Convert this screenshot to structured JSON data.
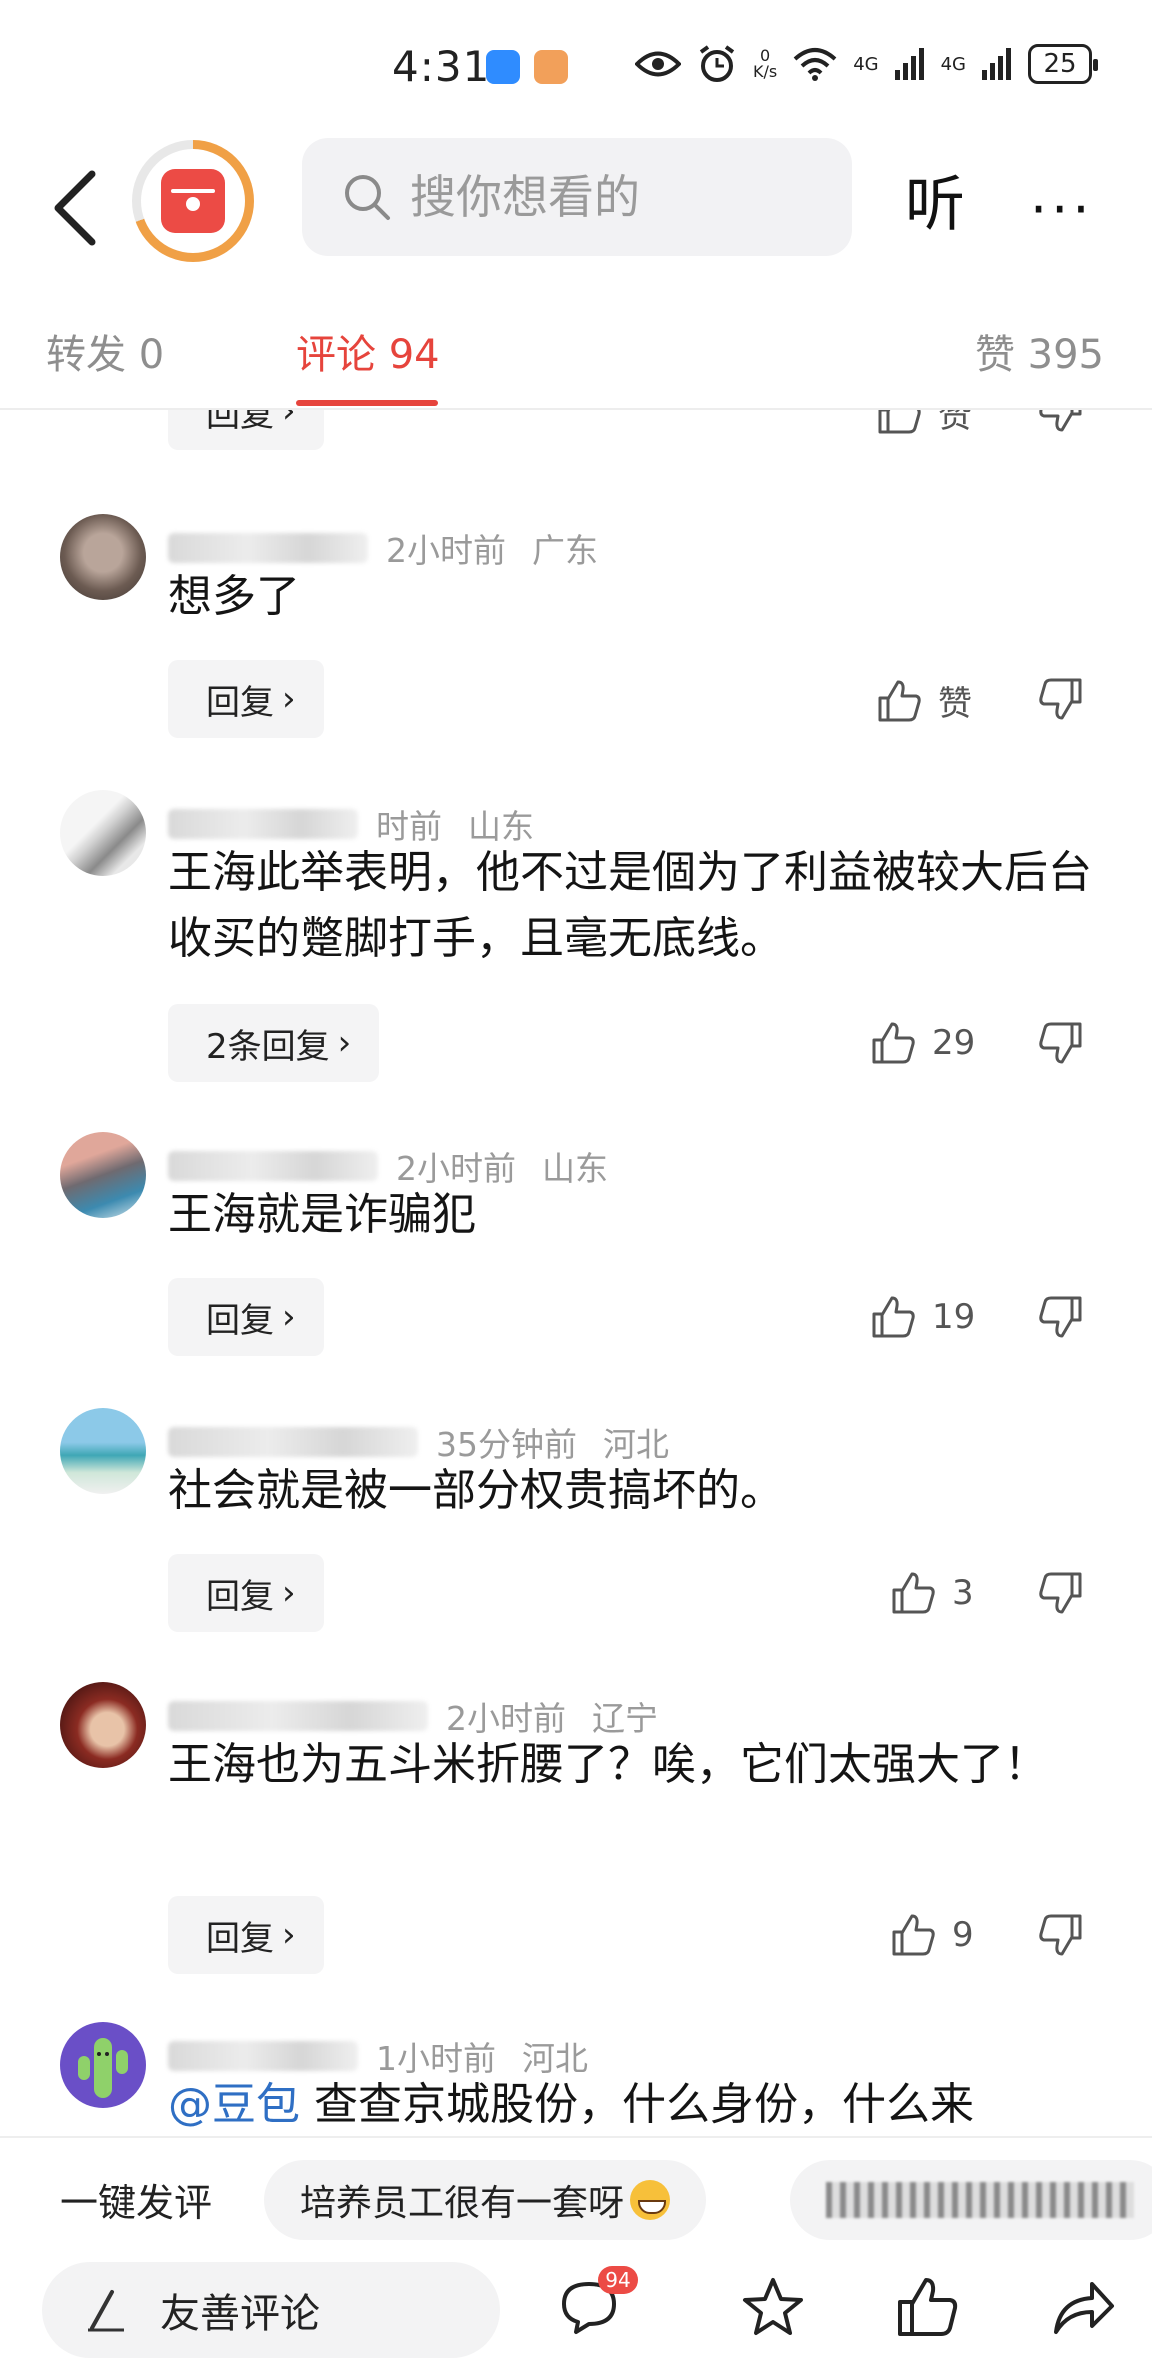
{
  "status_bar": {
    "time": "4:31",
    "net_speed_value": "0",
    "net_speed_unit": "K/s",
    "signal_1": "4G",
    "signal_2": "4G",
    "battery": "25"
  },
  "header": {
    "search_placeholder": "搜你想看的",
    "listen_label": "听",
    "more_label": "···"
  },
  "tabs": {
    "forward": "转发 0",
    "comments": "评论 94",
    "likes": "赞 395"
  },
  "partial_row": {
    "reply_label": "回复",
    "like_label": "赞"
  },
  "comments": [
    {
      "time": "2小时前",
      "region": "广东",
      "text": "想多了",
      "reply_label": "回复",
      "like_label": "赞"
    },
    {
      "time": "时前",
      "region": "山东",
      "text": "王海此举表明，他不过是個为了利益被较大后台收买的蹩脚打手，且毫无底线。",
      "reply_label": "2条回复",
      "like_label": "29"
    },
    {
      "time": "2小时前",
      "region": "山东",
      "text": "王海就是诈骗犯",
      "reply_label": "回复",
      "like_label": "19"
    },
    {
      "time": "35分钟前",
      "region": "河北",
      "text": "社会就是被一部分权贵搞坏的。",
      "reply_label": "回复",
      "like_label": "3"
    },
    {
      "time": "2小时前",
      "region": "辽宁",
      "text": "王海也为五斗米折腰了？唉，它们太强大了！",
      "reply_label": "回复",
      "like_label": "9"
    },
    {
      "time": "1小时前",
      "region": "河北",
      "mention": "@豆包",
      "text": " 查查京城股份，什么身份，什么来"
    }
  ],
  "quick_reply": {
    "label": "一键发评",
    "chip_1": "培养员工很有一套呀"
  },
  "bottom_bar": {
    "compose_placeholder": "友善评论",
    "comment_count_badge": "94"
  },
  "colors": {
    "accent": "#e6443c",
    "mention": "#2f6fc4",
    "chip_bg": "#f4f4f5"
  },
  "icons": [
    "back-icon",
    "app-logo",
    "search-icon",
    "thumbs-up-icon",
    "thumbs-down-icon",
    "comment-icon",
    "star-icon",
    "share-icon",
    "pen-icon"
  ]
}
